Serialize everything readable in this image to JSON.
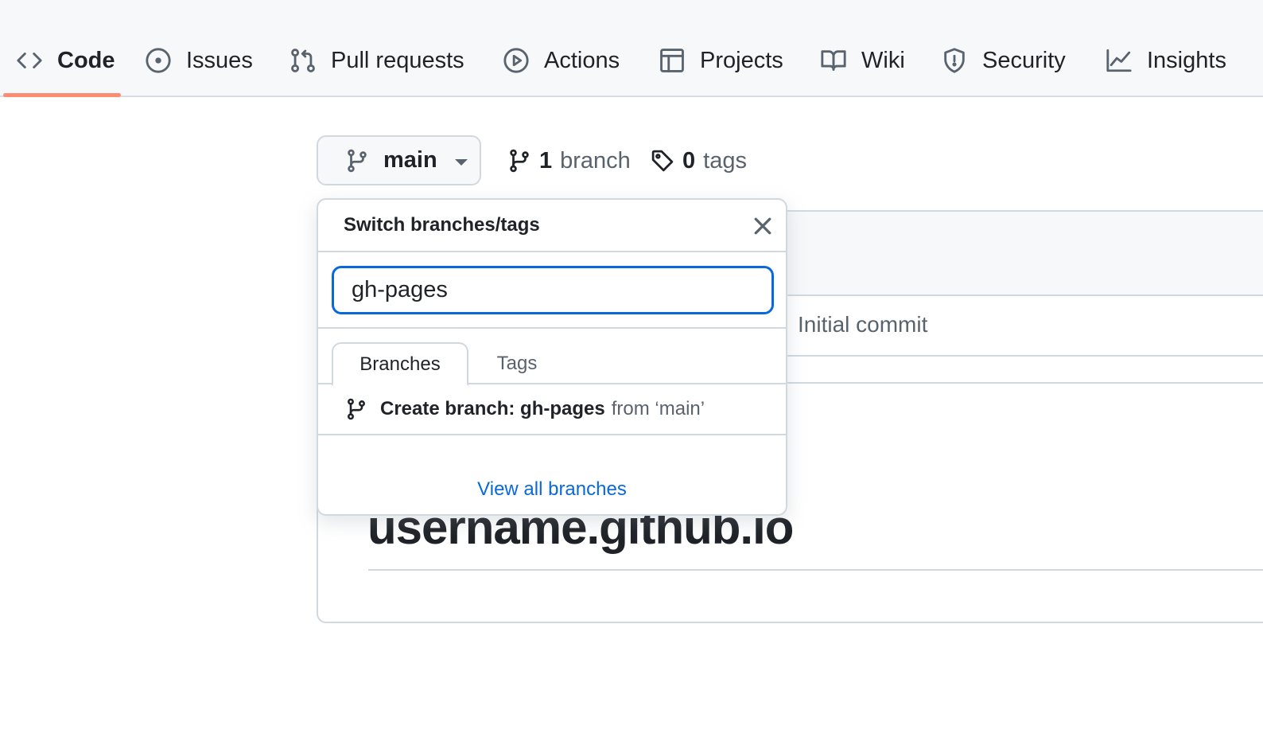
{
  "nav": {
    "items": [
      {
        "label": "Code",
        "icon": "code-icon",
        "selected": true
      },
      {
        "label": "Issues",
        "icon": "issue-opened-icon"
      },
      {
        "label": "Pull requests",
        "icon": "git-pull-request-icon"
      },
      {
        "label": "Actions",
        "icon": "play-icon"
      },
      {
        "label": "Projects",
        "icon": "table-icon"
      },
      {
        "label": "Wiki",
        "icon": "book-icon"
      },
      {
        "label": "Security",
        "icon": "shield-icon"
      },
      {
        "label": "Insights",
        "icon": "graph-icon"
      }
    ],
    "selected_underline_color": "#fd8c73"
  },
  "toolbar": {
    "branch_button_label": "main",
    "branch_count": "1",
    "branch_text": "branch",
    "tag_count": "0",
    "tag_text": "tags"
  },
  "background": {
    "commit_message": "Initial commit",
    "readme_heading": "username.github.io"
  },
  "dropdown": {
    "title": "Switch branches/tags",
    "filter_value": "gh-pages",
    "tabs": [
      {
        "label": "Branches",
        "active": true
      },
      {
        "label": "Tags",
        "active": false
      }
    ],
    "create_prefix": "Create branch: gh-pages",
    "create_suffix": "from ‘main’",
    "view_all_label": "View all branches",
    "focus_color": "#0969da",
    "link_color": "#0969da"
  }
}
